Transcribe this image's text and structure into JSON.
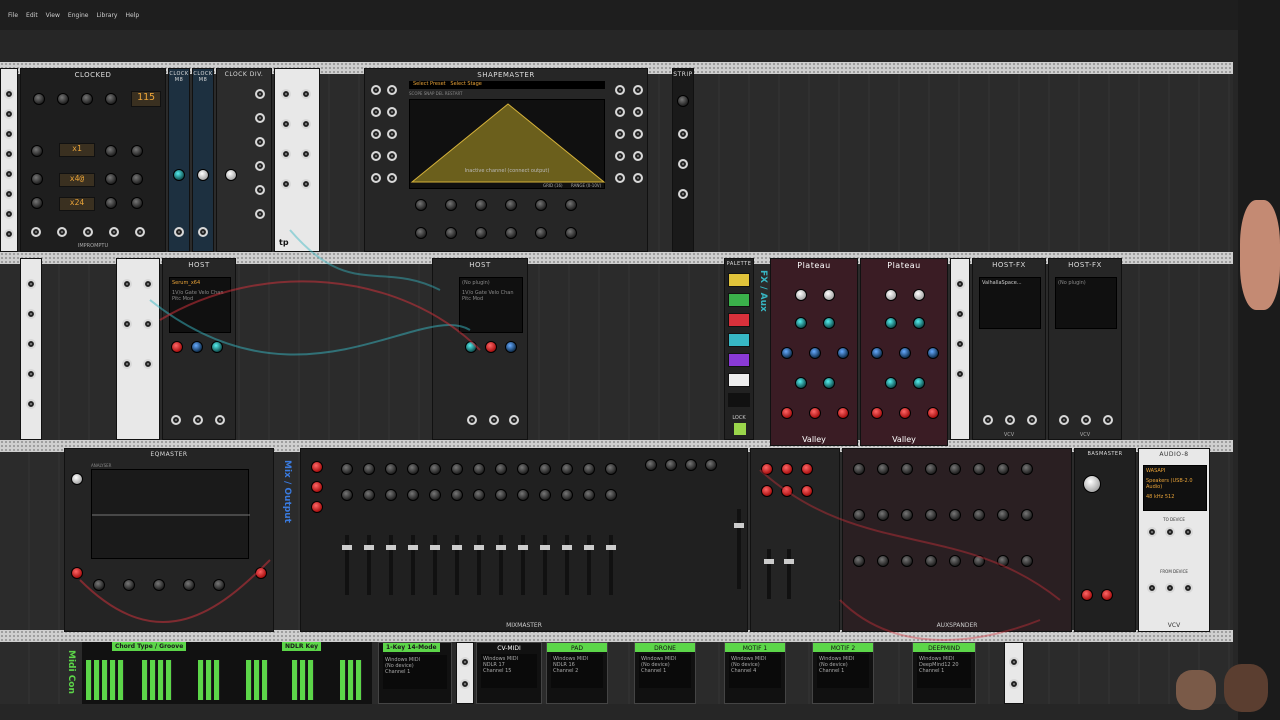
{
  "menu": [
    "File",
    "Edit",
    "View",
    "Engine",
    "Library",
    "Help"
  ],
  "row1": {
    "clocked": {
      "title": "CLOCKED",
      "bpm": "115",
      "ratio1": "x4@",
      "ratio2": "x24",
      "ratio0": "x1",
      "brand": "IMPROMPTU"
    },
    "clockmod": {
      "title1": "CLOCK M8",
      "title2": "CLOCK M8"
    },
    "clockdiv": {
      "title": "CLOCK DIV."
    },
    "tp": {
      "label": "tp"
    },
    "shapemaster": {
      "title": "SHAPEMASTER",
      "preset": "Select Preset",
      "stage": "Select Stage",
      "tabs": "SCOPE  SNAP  DEL  RESTART",
      "status": "Inactive channel (connect output)",
      "grid": "GRID (16)",
      "range": "RANGE (0-10V)"
    },
    "strip": {
      "title": "STRIP"
    }
  },
  "row2": {
    "host1": {
      "title": "HOST",
      "plugin": "Serum_x64",
      "params": "1V/o Gate Velo Chan\nPitc Mod"
    },
    "host2": {
      "title": "HOST",
      "plugin": "(No plugin)",
      "params": "1V/o Gate Velo Chan\nPitc Mod"
    },
    "palette": {
      "title": "PALETTE",
      "lock": "LOCK"
    },
    "fx_aux": {
      "label": "FX / Aux"
    },
    "plateau1": {
      "title": "Plateau",
      "brand": "Valley"
    },
    "plateau2": {
      "title": "Plateau",
      "brand": "Valley"
    },
    "hostfx1": {
      "title": "HOST-FX",
      "plugin": "ValhallaSpace..."
    },
    "hostfx2": {
      "title": "HOST-FX",
      "plugin": "(No plugin)"
    },
    "vcv": "VCV"
  },
  "row3": {
    "eqmaster": {
      "title": "EQMASTER",
      "footer": "ANALYSER"
    },
    "mix_output": {
      "label": "Mix / Output"
    },
    "mixmaster": {
      "title": "MIXMASTER"
    },
    "auxspander": {
      "title": "AUXSPANDER"
    },
    "basmaster": {
      "title": "BASMASTER"
    },
    "audio8": {
      "title": "AUDIO-8",
      "driver": "WASAPI",
      "device": "Speakers (USB-2.0\nAudio)",
      "rate": "48 kHz",
      "block": "512",
      "to_device": "TO DEVICE",
      "from_device": "FROM DEVICE"
    }
  },
  "row4": {
    "midi_con": {
      "label": "Midi Con"
    },
    "chord_tag": "Chord Type / Groove",
    "ndlr_tag": "NDLR Key",
    "keys_tag": "1-Key 14-Mode",
    "modules": [
      {
        "title": "CV-MIDI",
        "line1": "Windows MIDI",
        "line2": "NDLR 17",
        "line3": "Channel 15"
      },
      {
        "title": "PAD",
        "line1": "Windows MIDI",
        "line2": "NDLR 16",
        "line3": "Channel 2"
      },
      {
        "title": "DRONE",
        "line1": "Windows MIDI",
        "line2": "(No device)",
        "line3": "Channel 1"
      },
      {
        "title": "MOTIF 1",
        "line1": "Windows MIDI",
        "line2": "(No device)",
        "line3": "Channel 4"
      },
      {
        "title": "MOTIF 2",
        "line1": "Windows MIDI",
        "line2": "(No device)",
        "line3": "Channel 1"
      },
      {
        "title": "DEEPMIND",
        "line1": "Windows MIDI",
        "line2": "DeepMind12 20",
        "line3": "Channel 1"
      }
    ],
    "first_midi": {
      "line1": "Windows MIDI",
      "line2": "(No device)",
      "line3": "Channel 1"
    }
  },
  "colors": {
    "accent": "#e9a338",
    "green": "#5cd649",
    "red": "#d9313b",
    "teal": "#37b7c4",
    "blue": "#3a7be0"
  }
}
